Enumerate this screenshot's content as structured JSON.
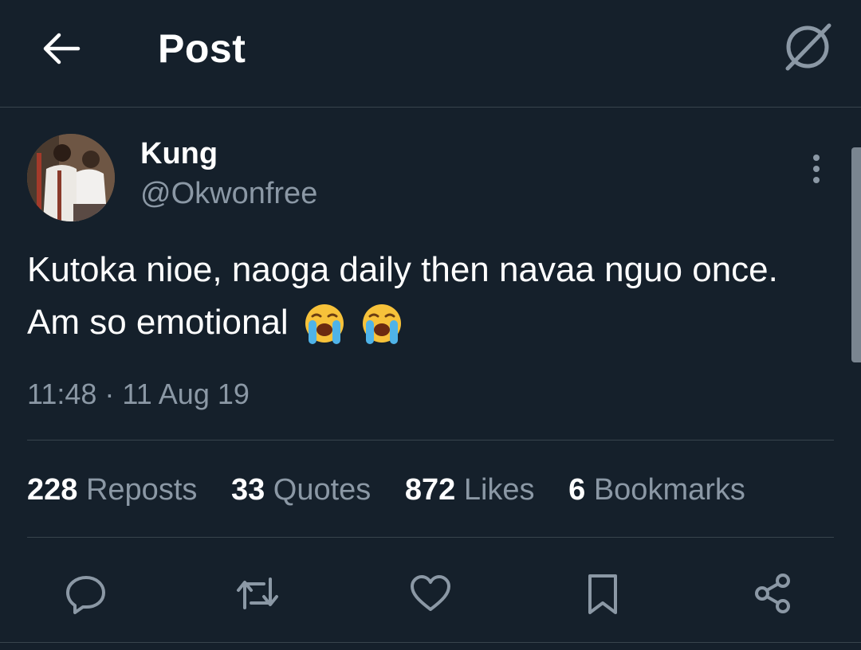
{
  "header": {
    "title": "Post",
    "back_icon": "arrow-left-icon",
    "action_icon": "no-sign-icon"
  },
  "tweet": {
    "author_name": "Kung",
    "author_handle": "@Okwonfree",
    "text": "Kutoka nioe, naoga daily then navaa nguo once. Am so emotional",
    "emojis": [
      "loudly-crying-face",
      "loudly-crying-face"
    ],
    "timestamp": "11:48 · 11 Aug 19"
  },
  "stats": [
    {
      "count": "228",
      "label": "Reposts"
    },
    {
      "count": "33",
      "label": "Quotes"
    },
    {
      "count": "872",
      "label": "Likes"
    },
    {
      "count": "6",
      "label": "Bookmarks"
    }
  ],
  "actions": [
    "reply-icon",
    "repost-icon",
    "like-icon",
    "bookmark-icon",
    "share-icon"
  ],
  "colors": {
    "background": "#15202b",
    "muted_text": "#8b98a5",
    "divider": "#38444d",
    "text": "#ffffff"
  }
}
